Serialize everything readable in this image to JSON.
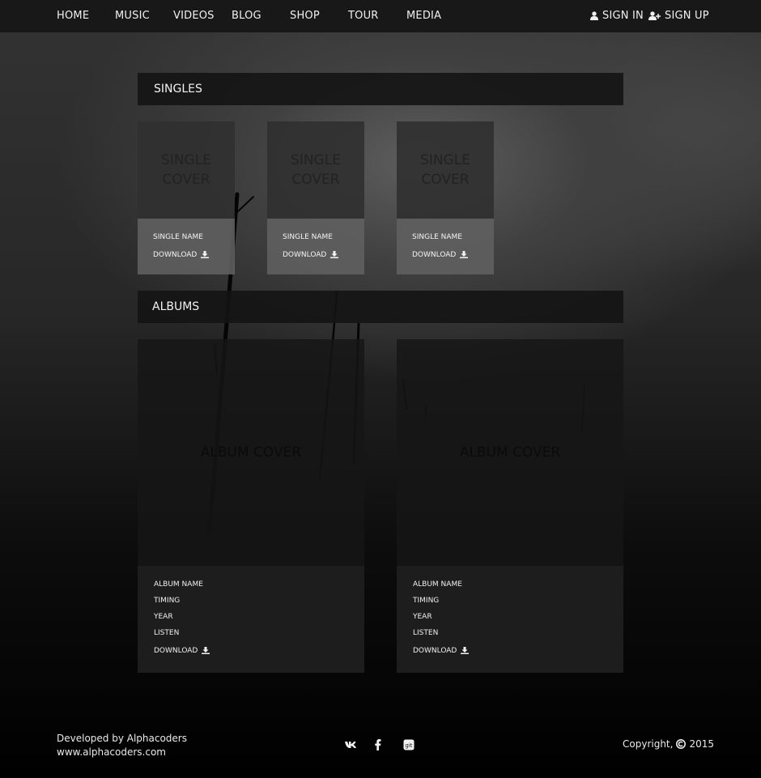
{
  "nav": {
    "items": [
      {
        "label": "HOME"
      },
      {
        "label": "MUSIC"
      },
      {
        "label": "VIDEOS"
      },
      {
        "label": "BLOG"
      },
      {
        "label": "SHOP"
      },
      {
        "label": "TOUR"
      },
      {
        "label": "MEDIA"
      }
    ],
    "sign_in": "SIGN IN",
    "sign_up": "SIGN UP"
  },
  "singles": {
    "title": "SINGLES",
    "items": [
      {
        "cover_line1": "SINGLE",
        "cover_line2": "COVER",
        "name": "SINGLE NAME",
        "download": "DOWNLOAD"
      },
      {
        "cover_line1": "SINGLE",
        "cover_line2": "COVER",
        "name": "SINGLE NAME",
        "download": "DOWNLOAD"
      },
      {
        "cover_line1": "SINGLE",
        "cover_line2": "COVER",
        "name": "SINGLE NAME",
        "download": "DOWNLOAD"
      }
    ]
  },
  "albums": {
    "title": "ALBUMS",
    "items": [
      {
        "cover": "ALBUM COVER",
        "name": "ALBUM NAME",
        "timing": "TIMING",
        "year": "YEAR",
        "listen": "LISTEN",
        "download": "DOWNLOAD"
      },
      {
        "cover": "ALBUM COVER",
        "name": "ALBUM NAME",
        "timing": "TIMING",
        "year": "YEAR",
        "listen": "LISTEN",
        "download": "DOWNLOAD"
      }
    ]
  },
  "footer": {
    "developed_by": "Developed by Alphacoders",
    "website": "www.alphacoders.com",
    "copyright": "Copyright,",
    "year": "2015",
    "social_icons": [
      "vk-icon",
      "facebook-icon",
      "git-icon"
    ]
  },
  "colors": {
    "nav_bg": "#161616",
    "header_bg": "#141414",
    "single_meta_bg": "#5f5f5f",
    "album_meta_bg": "#1d1d1d",
    "text": "#f0f0f0"
  }
}
